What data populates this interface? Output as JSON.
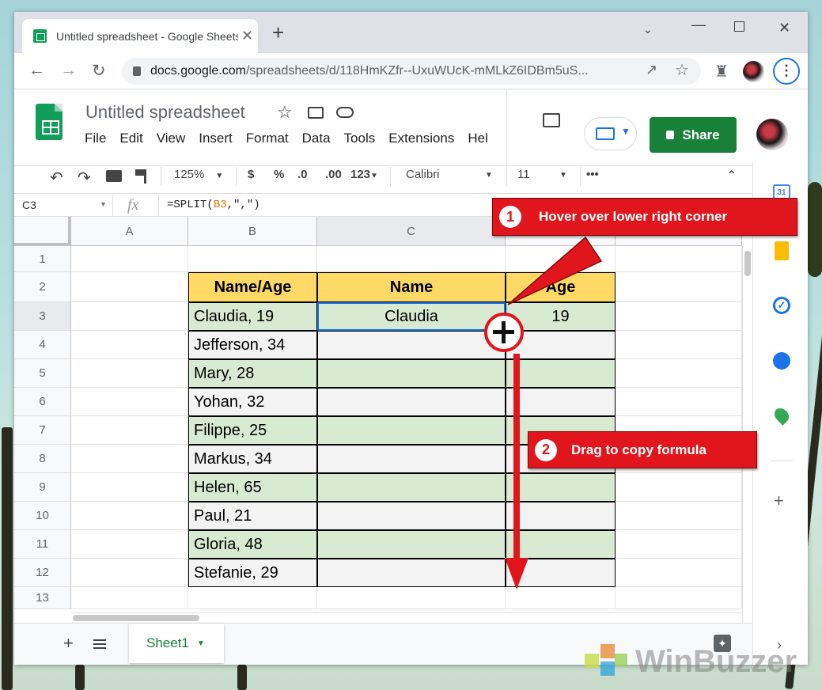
{
  "browser": {
    "tab_title": "Untitled spreadsheet - Google Sheets",
    "url_host": "docs.google.com",
    "url_path": "/spreadsheets/d/118HmKZfr--UxuWUcK-mMLkZ6IDBm5uS..."
  },
  "doc": {
    "title": "Untitled spreadsheet",
    "menu": [
      "File",
      "Edit",
      "View",
      "Insert",
      "Format",
      "Data",
      "Tools",
      "Extensions",
      "Hel"
    ],
    "share_label": "Share"
  },
  "toolbar": {
    "zoom": "125%",
    "currency": "$",
    "percent": "%",
    "dec_less": ".0",
    "dec_more": ".00",
    "more_formats": "123",
    "font": "Calibri",
    "font_size": "11",
    "more": "•••"
  },
  "formula_bar": {
    "name_box": "C3",
    "fx": "fx",
    "formula_prefix": "=SPLIT(",
    "formula_ref": "B3",
    "formula_suffix": ",\",\")"
  },
  "columns": [
    "A",
    "B",
    "C",
    ""
  ],
  "rows": [
    "1",
    "2",
    "3",
    "4",
    "5",
    "6",
    "7",
    "8",
    "9",
    "10",
    "11",
    "12",
    "13"
  ],
  "table": {
    "headers": [
      "Name/Age",
      "Name",
      "Age"
    ],
    "names": [
      "Claudia, 19",
      "Jefferson, 34",
      "Mary, 28",
      "Yohan, 32",
      "Filippe, 25",
      "Markus, 34",
      "Helen, 65",
      "Paul, 21",
      "Gloria, 48",
      "Stefanie, 29"
    ],
    "c3": "Claudia",
    "d3": "19"
  },
  "sheet": {
    "tab": "Sheet1"
  },
  "annotations": {
    "step1_num": "1",
    "step1": "Hover over lower right corner",
    "step2_num": "2",
    "step2": "Drag to copy formula"
  },
  "watermark": "WinBuzzer",
  "colors": {
    "header_fill": "#ffd966",
    "green_row": "#d9ead3",
    "white_row": "#f3f3f3",
    "callout_red": "#e0161c",
    "share_green": "#188038"
  }
}
